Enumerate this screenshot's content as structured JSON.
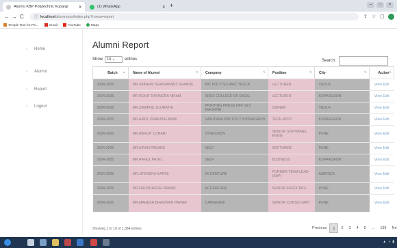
{
  "browser": {
    "tabs": [
      {
        "title": "Alumni KBP Polytechnic Kopargr",
        "icon_color": "#c9c9c9",
        "close": "x"
      },
      {
        "title": "(1) WhatsApp",
        "icon_color": "#2ec469",
        "close": "x"
      }
    ],
    "new_tab": "+",
    "url_host": "localhost",
    "url_path": "/alumnisys/index.php?menu=report",
    "bookmarks": [
      {
        "label": "Temple Run for PC...",
        "color": "#d9822b"
      },
      {
        "label": "Gmail",
        "color": "#d93025"
      },
      {
        "label": "YouTube",
        "color": "#e62117"
      },
      {
        "label": "Maps",
        "color": "#34a853"
      }
    ]
  },
  "sidebar": {
    "items": [
      {
        "label": "Home"
      },
      {
        "label": "Alumni"
      },
      {
        "label": "Report"
      },
      {
        "label": "Logout"
      }
    ]
  },
  "page": {
    "title": "Alumni Report",
    "show_label": "Show",
    "show_value": "10",
    "entries_label": "entries",
    "search_label": "Search:"
  },
  "table": {
    "headers": [
      "Batch",
      "Name of Alumni",
      "Company",
      "Position",
      "City",
      "Action"
    ],
    "rows": [
      [
        "2004-2005",
        "MR.VAIBHAV SHASHIKANT DHANDE",
        "MIT POLYTECHNIC YEOLA",
        "LECTURER",
        "YEOLA",
        "View Edit"
      ],
      [
        "2004-2005",
        "MR.ROHIT RAVINDRA NIKAM",
        "SRES COLLEGE OF ENGG",
        "LECTURER",
        "KOPARGAON",
        "View Edit"
      ],
      [
        "2004-2005",
        "MR.SWAPNIL GUJRATHI",
        "PRINTING PRESS OFF SET MACHINE",
        "OWNER",
        "YEOLA",
        "View Edit"
      ],
      [
        "2004-2005",
        "MR.AMOL PRAKASH ABAK",
        "SANJIVANI KBP POLY KOPARGAON",
        "TECH.ASST",
        "KOPARGAON",
        "View Edit"
      ],
      [
        "2004-2005",
        "MR.ABHIJIT LONARI",
        "SYNECRON",
        "SENIOR SOFTWARE ENGG",
        "PUNE",
        "View Edit"
      ],
      [
        "2004-2005",
        "MR.KIRAN PADADE",
        "SELF",
        "SOFTWARE",
        "PUNE",
        "View Edit"
      ],
      [
        "2004-2005",
        "MR.RAHUL PATEL",
        "SELF",
        "BUSINESS",
        "KOPARGAON",
        "View Edit"
      ],
      [
        "2004-2005",
        "MR.JITENDRA KAPSE",
        "ACCENTURE",
        "FORMER TEAM LEAD (SAP)",
        "AMERICA",
        "View Edit"
      ],
      [
        "2004-2005",
        "MR.HRUSHIKESH PAWAR",
        "ACCENTURE",
        "SENIOR ASSOCIATE",
        "PUNE",
        "View Edit"
      ],
      [
        "2004-2005",
        "MR.MAHESH BHAGWAN PAWAR",
        "CAPGEMINI",
        "SENIOR CONSULTANT",
        "PUNE",
        "View Edit"
      ]
    ]
  },
  "footer": {
    "info": "Showing 1 to 10 of 1,384 entries",
    "pager": [
      "Previous",
      "1",
      "2",
      "3",
      "4",
      "5",
      "...",
      "139",
      "Next"
    ],
    "current_page": "1"
  },
  "colors": {
    "gray_cell": "#b6b6b6",
    "pink_cell": "#e8c6cf",
    "link": "#7aa4c8",
    "taskbar": "#1f3550"
  }
}
